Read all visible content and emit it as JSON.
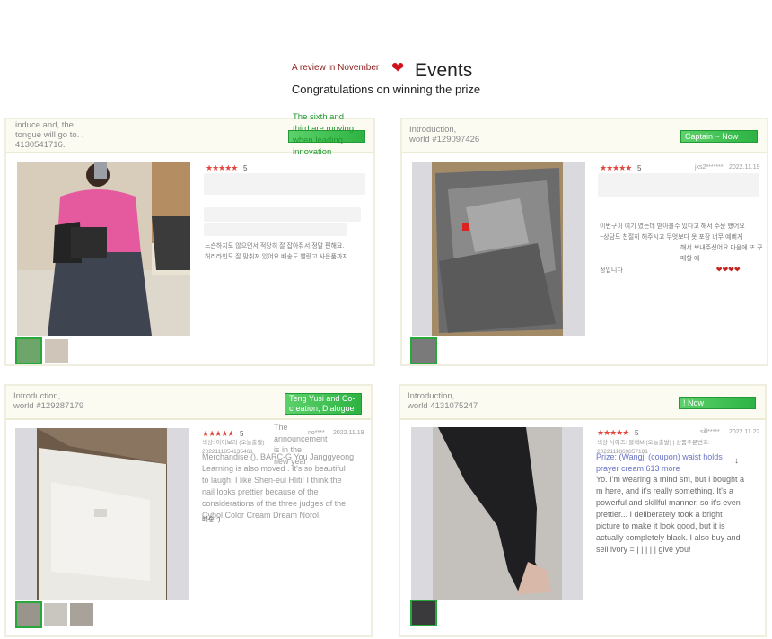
{
  "header": {
    "sub_label": "A review in November",
    "heart": "❤",
    "title": "Events",
    "congrats": "Congratulations on winning the prize"
  },
  "cards": [
    {
      "intro_lines": [
        "induce and, the",
        "tongue will go to. .",
        "4130541716."
      ],
      "overlay_lines": [
        "The sixth and",
        "third are moving",
        "when leading",
        "innovation"
      ],
      "stars": "★★★★★",
      "score": "5",
      "review_lines": [
        "느슨하지도 않으면서 적당히 잘 잡아줘서 정말 편해요.",
        "허리라인도 잘 맞춰져 있어요 배송도 빨랐고 사은품까지"
      ]
    },
    {
      "intro_lines": [
        "Introduction,",
        "world #129097426"
      ],
      "tag": "Captain ~ Now",
      "stars": "★★★★★",
      "score": "5",
      "user": "jks2*******",
      "date": "2022.11.19",
      "review_lines": [
        "이번구이 여기 였는데 받아볼수 있다고 해서 주문 했어요",
        "~상담도 친절히 해주시고 무엇보다 옷 포장 너무 예뻐게",
        "해서 보내주셨어요 다음에 또 구매할 예",
        "정입니다"
      ],
      "hearts": "❤❤❤❤"
    },
    {
      "intro_lines": [
        "Introduction,",
        "world #129287179"
      ],
      "tag_lines": [
        "Teng Yusi and Co-",
        "creation, Dialogue"
      ],
      "overlay_lines": [
        "The",
        "announcement",
        "is in the",
        "new year"
      ],
      "stars": "★★★★★",
      "score": "5",
      "user": "no****",
      "date": "2022.11.19",
      "meta_lines": [
        "색상: 아이보리 (오늘출발)",
        "2022111854135461"
      ],
      "body_lines": [
        "Merchandise (). BARC-G You Janggyeong",
        "Learning is also moved . It's so beautiful",
        "to laugh. I like Shen-eul Hliti! I think the",
        "nail looks prettier because of the",
        "considerations of the three judges of the",
        "Cybol Color Cream Dream Norol."
      ],
      "closing": "배송 :)"
    },
    {
      "intro_lines": [
        "Introduction,",
        "world 4131075247"
      ],
      "tag": "! Now",
      "stars": "★★★★★",
      "score": "5",
      "user": "sill*****",
      "date": "2022.11.22",
      "meta_lines": [
        "색상 사이즈: 블랙M (오늘출발) | 상품주문번호:",
        "2022111869857181"
      ],
      "prize_lines": [
        "Prize: (Wangji (coupon) waist holds",
        "prayer cream 613 more"
      ],
      "arrow": "↓",
      "body_lines": [
        "Yo. I'm wearing a mind sm, but I bought a",
        "m here, and it's really something. It's a",
        "powerful and skillful manner, so it's even",
        "prettier... I deliberately took a bright",
        "picture to make it look good, but it is",
        "actually completely black. I also buy and",
        "sell ivory = | | | | | give you!"
      ]
    }
  ],
  "colors": {
    "accent_green": "#2db343",
    "heart_red": "#d0111b",
    "header_red": "#8b1a1a"
  }
}
